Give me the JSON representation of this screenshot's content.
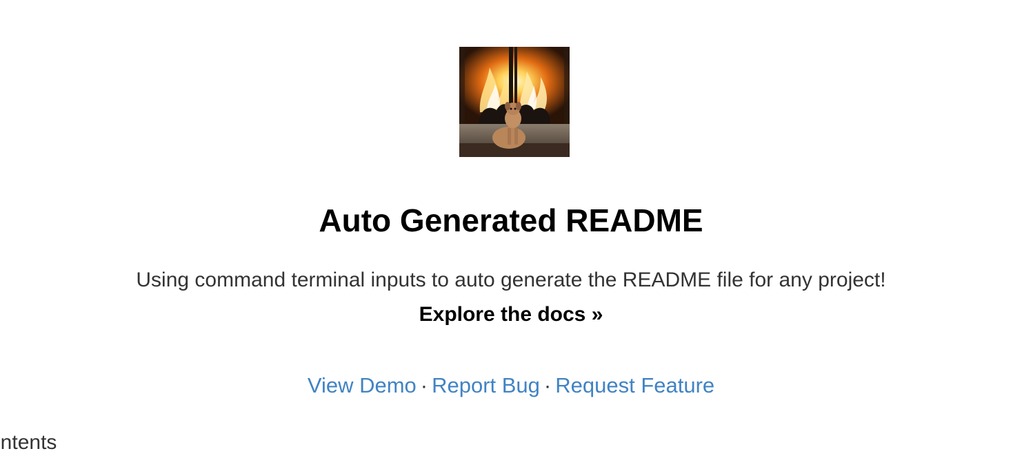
{
  "header": {
    "logo_alt": "Logo",
    "title": "Auto Generated README",
    "description": "Using command terminal inputs to auto generate the README file for any project!",
    "docs_link": "Explore the docs »"
  },
  "links": {
    "demo": "View Demo",
    "report_bug": "Report Bug",
    "request_feature": "Request Feature",
    "separator": "·"
  },
  "toc": {
    "partial_heading": "ontents"
  },
  "colors": {
    "link": "#4183c4",
    "text": "#333333",
    "heading": "#000000"
  }
}
